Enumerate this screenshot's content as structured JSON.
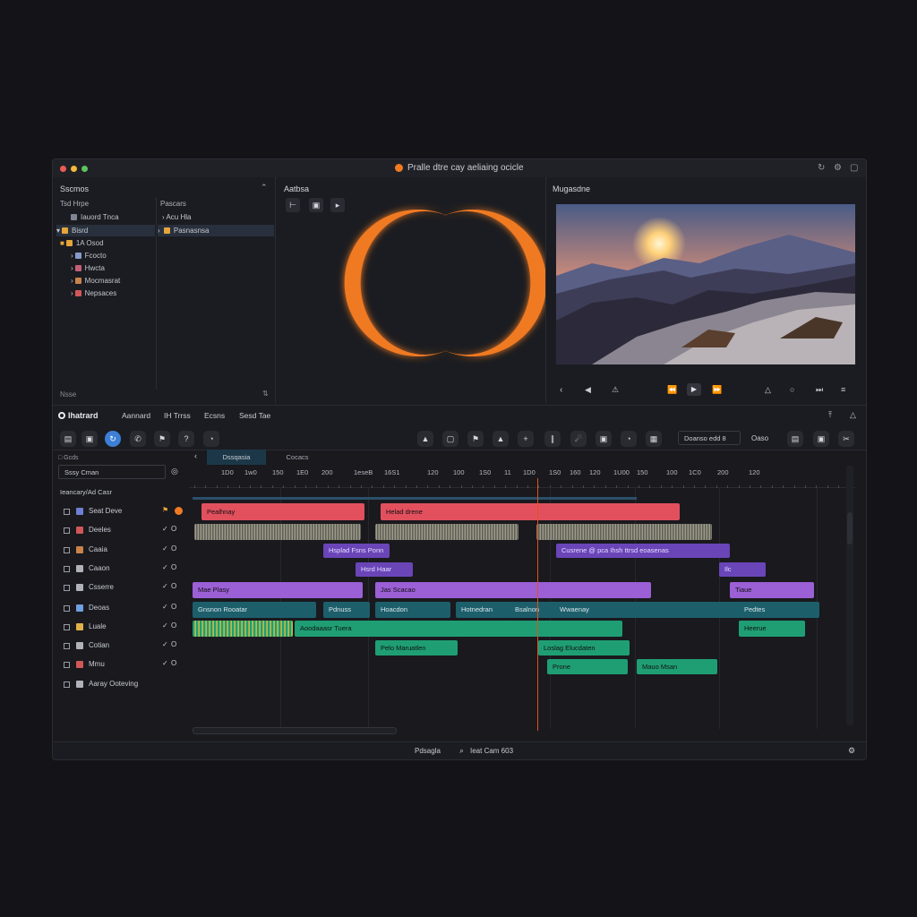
{
  "window": {
    "title": "Pralle dtre cay aeliaing ocicle",
    "colors": {
      "accent": "#f07a22",
      "red": "#e2505e",
      "purple": "#9b5fd6",
      "violet": "#6a45b8",
      "teal": "#1d5e6b",
      "green": "#1f9e74",
      "playhead": "#e0531f"
    }
  },
  "project_panel": {
    "header": "Sscmos",
    "col1_title": "Tsd Hrpe",
    "col2_title": "Pascars",
    "tree": [
      {
        "label": "Iauord Tnca"
      },
      {
        "label": "Bisrd"
      },
      {
        "label": "1A Osod"
      },
      {
        "label": "Fcocto"
      },
      {
        "label": "Hwcta"
      },
      {
        "label": "Mocmasrat"
      },
      {
        "label": "Nepsaces"
      }
    ],
    "col2_items": [
      {
        "label": "Acu Hla"
      },
      {
        "label": "Pasnasnsa"
      }
    ],
    "footer": "Nsse"
  },
  "effects_panel": {
    "header": "Aatbsa"
  },
  "viewer_panel": {
    "header": "Mugasdne"
  },
  "menu": {
    "app": "Ihatrard",
    "items": [
      "Aannard",
      "IH Trrss",
      "Ecsns",
      "Sesd Tae"
    ]
  },
  "toolbar": {
    "search_value": "Doanso edd",
    "search_suffix": "8",
    "btn_label": "Oaso"
  },
  "timeline": {
    "tabs": [
      "Dssqasia",
      "Cocacs"
    ],
    "track_search": "Sssy Cman",
    "group_label": "Ieancary/Ad Casr",
    "tracks": [
      {
        "name": "Seat Deve"
      },
      {
        "name": "Deeles"
      },
      {
        "name": "Caaia"
      },
      {
        "name": "Caaon"
      },
      {
        "name": "Csserre"
      },
      {
        "name": "Deoas"
      },
      {
        "name": "Luale"
      },
      {
        "name": "Cotian"
      },
      {
        "name": "Mmu"
      },
      {
        "name": "Aaray Ooteving"
      }
    ],
    "ruler_labels": [
      "1D0",
      "1w0",
      "150",
      "1E0",
      "200",
      "1eseB",
      "16S1",
      "120",
      "100",
      "1S0",
      "11",
      "1D0",
      "1S0",
      "160",
      "120",
      "1U00",
      "150",
      "100",
      "1C0",
      "200",
      "120"
    ],
    "clips": [
      {
        "label": "Pealhnay"
      },
      {
        "label": "Helad drene"
      },
      {
        "label": "Hsplad Fsns Ponn"
      },
      {
        "label": "Cusrene @ pca Ihsh ttrsd eoasenas"
      },
      {
        "label": "Hsrd Haar"
      },
      {
        "label": "Ilc"
      },
      {
        "label": "Mae Plasy"
      },
      {
        "label": "Jas Scacao"
      },
      {
        "label": "Tiaue"
      },
      {
        "label": "Gnsnon Rooatar"
      },
      {
        "label": "Pdnuss"
      },
      {
        "label": "Hoacdon"
      },
      {
        "label": "Hotnedran"
      },
      {
        "label": "Bsalnon"
      },
      {
        "label": "Wwaenay"
      },
      {
        "label": "Pedtes"
      },
      {
        "label": "Aoodaaasr Tuera"
      },
      {
        "label": "Heerue"
      },
      {
        "label": "Pelo Maruatlen"
      },
      {
        "label": "Loslag Elucdaten"
      },
      {
        "label": "Prone"
      },
      {
        "label": "Mauo Msan"
      }
    ],
    "status": "Pdsagla",
    "status_value": "Ieat Cam 603"
  }
}
